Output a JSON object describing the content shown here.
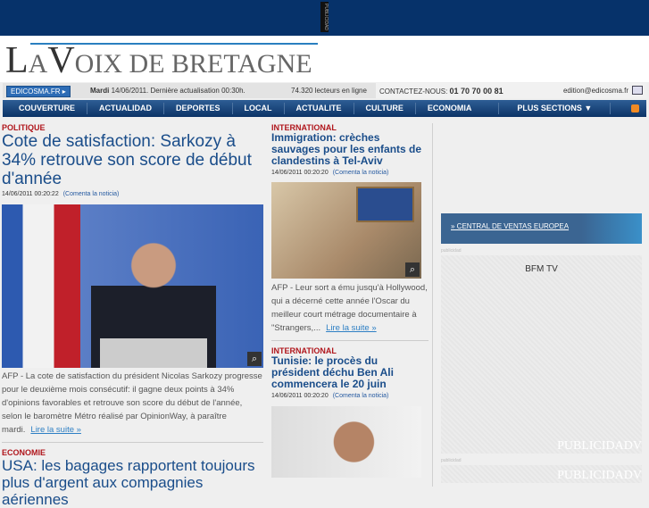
{
  "top_ad": {
    "label": "PUBLICIDAD"
  },
  "logo": {
    "l1": "L",
    "l2": "A ",
    "l3": "V",
    "l4": "OIX DE BRETAGNE"
  },
  "infobar": {
    "site": "EDICOSMA.FR ▸",
    "day": "Mardi",
    "date": "14/06/2011. Dernière actualisation 00:30h.",
    "readers": "74.320 lecteurs en ligne",
    "contact_label": "CONTACTEZ-NOUS:",
    "phone": "01 70 70 00 81",
    "email": "edition@edicosma.fr"
  },
  "nav": [
    "COUVERTURE",
    "ACTUALIDAD",
    "DEPORTES",
    "LOCAL",
    "ACTUALITE",
    "CULTURE",
    "ECONOMIA",
    "PLUS SECTIONS ▼"
  ],
  "articles": [
    {
      "category": "POLITIQUE",
      "title": "Cote de satisfaction: Sarkozy à 34% retrouve son score de début d'année",
      "date": "14/06/2011 00:20:22",
      "comment": "(Comenta la noticia)",
      "body": "AFP - La cote de satisfaction du président Nicolas Sarkozy progresse pour le deuxième mois consécutif: il gagne deux points à 34% d'opinions favorables et retrouve son score du début de l'année, selon le baromètre Métro réalisé par OpinionWay, à paraître mardi.",
      "more": "Lire la suite »"
    },
    {
      "category": "ECONOMIE",
      "title": "USA: les bagages rapportent toujours plus d'argent aux compagnies aériennes"
    },
    {
      "category": "INTERNATIONAL",
      "title": "Immigration: crèches sauvages pour les enfants de clandestins à Tel-Aviv",
      "date": "14/06/2011 00:20:20",
      "comment": "(Comenta la noticia)",
      "body": "AFP - Leur sort a ému jusqu'à Hollywood, qui a décerné cette année l'Oscar du meilleur court métrage documentaire à \"Strangers,...",
      "more": "Lire la suite »"
    },
    {
      "category": "INTERNATIONAL",
      "title": "Tunisie: le procès du président déchu Ben Ali commencera le 20 juin",
      "date": "14/06/2011 00:20:20",
      "comment": "(Comenta la noticia)"
    }
  ],
  "sidebar": {
    "banner": "» CENTRAL DE VENTAS EUROPEA",
    "ad_label": "publicidad",
    "ad1_title": "BFM TV",
    "ad_watermark": "PUBLICIDADV"
  }
}
